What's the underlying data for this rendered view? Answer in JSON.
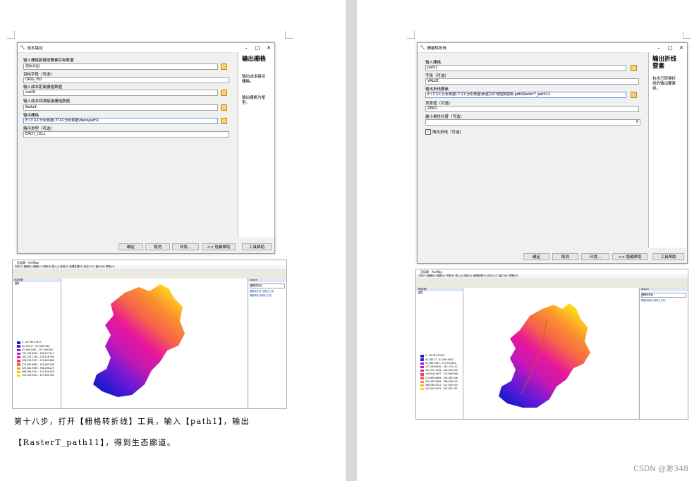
{
  "left_dialog": {
    "title": "成本路径",
    "f1_label": "输入栅格数据或要素目标数据",
    "f1_value": "居民公园",
    "f2_label": "目标字段（可选）",
    "f2_value": "ORIG_FID",
    "f3_label": "输入成本距离栅格数据",
    "f3_value": "cost9",
    "f4_label": "输入成本回溯链接栅格数据",
    "f4_value": "Bailu9",
    "f5_label": "输出栅格",
    "f5_value": "E:\\下午C分析数据\\下午C分析数据\\data\\path1",
    "f6_label": "路径类型（可选）",
    "f6_value": "EACH_CELL",
    "side_title": "输出栅格",
    "side_p1": "输出成本路径栅格。",
    "side_p2": "输出栅格为整型。",
    "buttons": [
      "确定",
      "取消",
      "环境...",
      "<< 隐藏帮助",
      "工具帮助"
    ]
  },
  "right_dialog": {
    "title": "栅格转折线",
    "f1_label": "输入栅格",
    "f1_value": "path1",
    "f2_label": "字段（可选）",
    "f2_value": "VALUE",
    "f3_label": "输出折线要素",
    "f3_value": "E:\\下午C分析数据\\下午C分析数据\\新建文件地理数据库.gdb\\RasterT_path11",
    "f4_label": "背景值（可选）",
    "f4_value": "ZERO",
    "f5_label": "最小悬挂长度（可选）",
    "f5_value": "0",
    "chk_label": "简化折线（可选）",
    "side_title": "输出折线要素",
    "side_p1": "包含已转换折线的输出要素类。",
    "buttons": [
      "确定",
      "取消",
      "环境...",
      "<< 隐藏帮助",
      "工具帮助"
    ]
  },
  "left_arcmap": {
    "title": "无标题 - ArcMap",
    "menu": "文件(F)  编辑(E)  视图(V)  书签(B)  插入(I)  选择(S)  地理处理(G)  自定义(C)  窗口(W)  帮助(H)",
    "toc_title": "内容列表",
    "layers": "图层",
    "search_title": "Search",
    "search_query": "栅格转折线",
    "result1": "栅格转折线 (转换)(工具)",
    "result2": "栅格转面 (转换)(工具)",
    "legend": [
      {
        "c": "#1a1acc",
        "t": "0 - 45,783.27813"
      },
      {
        "c": "#4b1ad8",
        "t": "45,783.27 - 91,566.5562"
      },
      {
        "c": "#8e1ad0",
        "t": "91,566.5563 - 137,349.834"
      },
      {
        "c": "#c218b5",
        "t": "137,349.8345 - 183,133.112"
      },
      {
        "c": "#e8189a",
        "t": "183,133.1126 - 228,916.390"
      },
      {
        "c": "#f23a6e",
        "t": "228,916.3907 - 274,699.668"
      },
      {
        "c": "#f7634a",
        "t": "274,699.6689 - 320,482.946"
      },
      {
        "c": "#fb9030",
        "t": "320,482.9469 - 366,266.225"
      },
      {
        "c": "#fdb81e",
        "t": "366,266.2251 - 412,049.503"
      },
      {
        "c": "#ffd51a",
        "t": "412,049.5032 - 457,832.781"
      }
    ]
  },
  "right_arcmap": {
    "title": "无标题 - ArcMap",
    "menu": "文件(F)  编辑(E)  视图(V)  书签(B)  插入(I)  选择(S)  地理处理(G)  自定义(C)  窗口(W)  帮助(H)",
    "toc_title": "内容列表",
    "layers": "图层",
    "search_title": "Search",
    "search_query": "栅格转折线",
    "result1": "栅格转折线 (转换)(工具)",
    "legend": [
      {
        "c": "#1a1acc",
        "t": "0 - 45,783.27813"
      },
      {
        "c": "#4b1ad8",
        "t": "45,783.27 - 91,566.5562"
      },
      {
        "c": "#8e1ad0",
        "t": "91,566.5563 - 137,349.834"
      },
      {
        "c": "#c218b5",
        "t": "137,349.8345 - 183,133.112"
      },
      {
        "c": "#e8189a",
        "t": "183,133.1126 - 228,916.390"
      },
      {
        "c": "#f23a6e",
        "t": "228,916.3907 - 274,699.668"
      },
      {
        "c": "#f7634a",
        "t": "274,699.6689 - 320,482.946"
      },
      {
        "c": "#fb9030",
        "t": "320,482.9469 - 366,266.225"
      },
      {
        "c": "#fdb81e",
        "t": "366,266.2251 - 412,049.503"
      },
      {
        "c": "#ffd51a",
        "t": "412,049.5032 - 457,832.781"
      }
    ]
  },
  "body_text": {
    "line1": "第十八步，打开【栅格转折线】工具，输入【path1】，输出",
    "line2": "【RasterT_path11】，得到生态廊道。"
  },
  "watermark": "CSDN @渺348"
}
